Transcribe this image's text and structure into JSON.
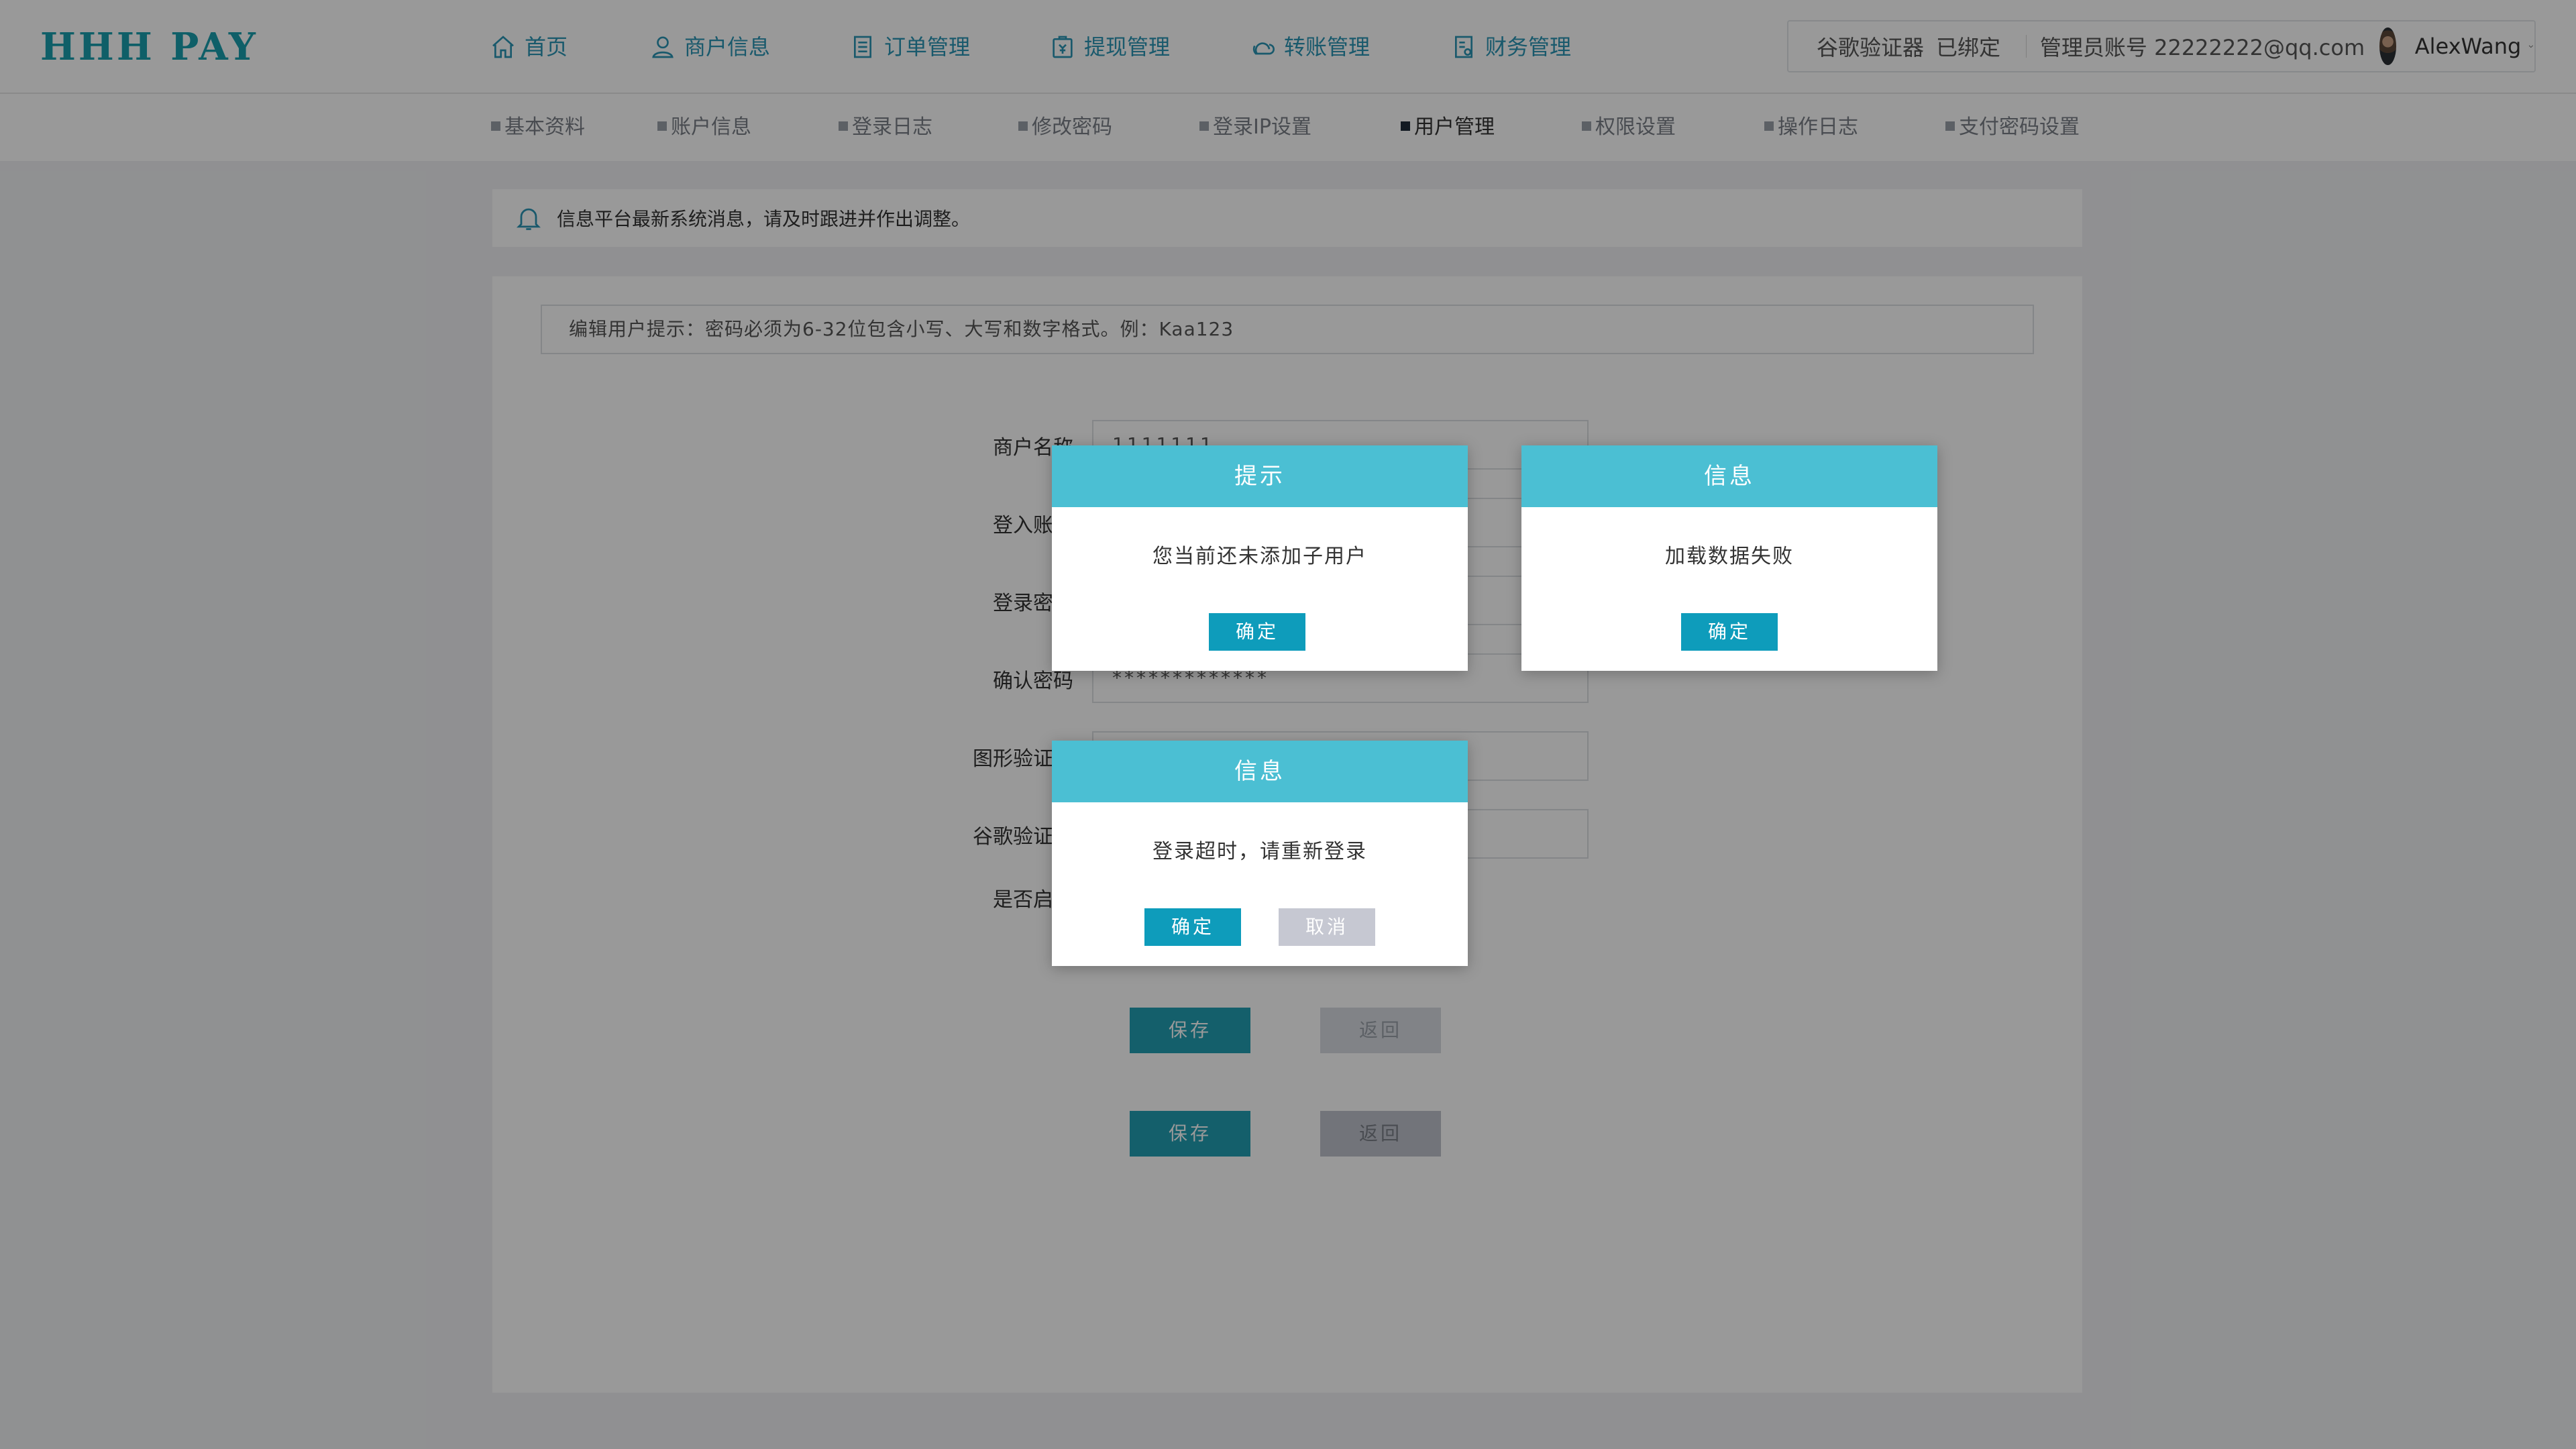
{
  "app": {
    "logo": "HHH PAY"
  },
  "nav": {
    "items": [
      {
        "label": "首页",
        "icon": "home-icon"
      },
      {
        "label": "商户信息",
        "icon": "user-icon"
      },
      {
        "label": "订单管理",
        "icon": "document-icon"
      },
      {
        "label": "提现管理",
        "icon": "wallet-icon"
      },
      {
        "label": "转账管理",
        "icon": "transfer-icon"
      },
      {
        "label": "财务管理",
        "icon": "ledger-icon"
      }
    ]
  },
  "account": {
    "authenticator_label": "谷歌验证器",
    "authenticator_status": "已绑定",
    "admin_label": "管理员账号",
    "admin_email": "22222222@qq.com",
    "username": "AlexWang"
  },
  "subnav": {
    "items": [
      {
        "label": "基本资料"
      },
      {
        "label": "账户信息"
      },
      {
        "label": "登录日志"
      },
      {
        "label": "修改密码"
      },
      {
        "label": "登录IP设置"
      },
      {
        "label": "用户管理",
        "active": true
      },
      {
        "label": "权限设置"
      },
      {
        "label": "操作日志"
      },
      {
        "label": "支付密码设置"
      }
    ]
  },
  "notice": {
    "text": "信息平台最新系统消息，请及时跟进并作出调整。"
  },
  "form": {
    "tip": "编辑用户提示：密码必须为6-32位包含小写、大写和数字格式。例：Kaa123",
    "fields": [
      {
        "label": "商户名称",
        "value": "1111111"
      },
      {
        "label": "登入账号",
        "value": ""
      },
      {
        "label": "登录密码",
        "value": ""
      },
      {
        "label": "确认密码",
        "value": "*************"
      },
      {
        "label": "图形验证码",
        "value": ""
      },
      {
        "label": "谷歌验证码",
        "value": ""
      },
      {
        "label": "是否启用",
        "value": ""
      }
    ],
    "save_label": "保存",
    "back_label": "返回"
  },
  "dialogs": [
    {
      "title": "提示",
      "message": "您当前还未添加子用户",
      "ok": "确定"
    },
    {
      "title": "信息",
      "message": "加载数据失败",
      "ok": "确定"
    },
    {
      "title": "信息",
      "message": "登录超时，请重新登录",
      "ok": "确定",
      "cancel": "取消"
    }
  ],
  "colors": {
    "brand": "#1a9eae",
    "dialog_header": "#4bbfd3",
    "primary_button": "#0e9cbb",
    "cancel_button": "#c6c8d2"
  }
}
